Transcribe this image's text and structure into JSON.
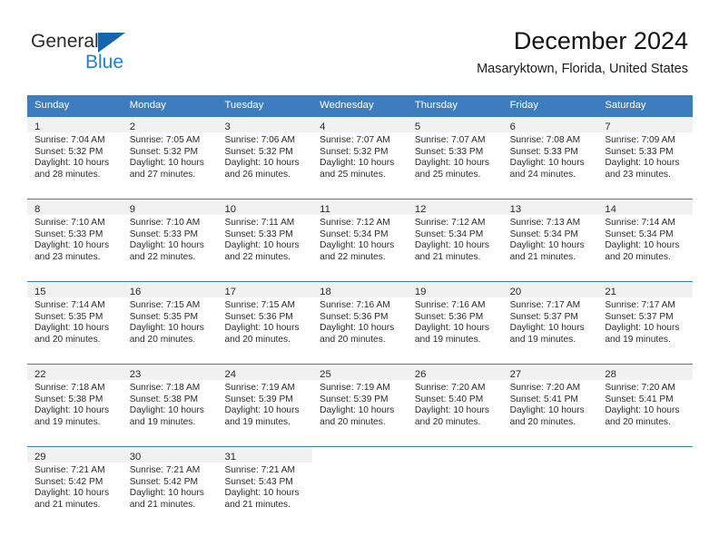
{
  "brand": {
    "name_part1": "General",
    "name_part2": "Blue"
  },
  "header": {
    "title": "December 2024",
    "location": "Masaryktown, Florida, United States"
  },
  "calendar": {
    "weekday_headers": [
      "Sunday",
      "Monday",
      "Tuesday",
      "Wednesday",
      "Thursday",
      "Friday",
      "Saturday"
    ],
    "colors": {
      "header_blue": "#3d7dbf",
      "brand_blue": "#1f7fd4",
      "logo_triangle": "#1565b0",
      "day_band_gray": "#f1f1f1"
    },
    "weeks": [
      [
        {
          "day": "1",
          "sunrise": "Sunrise: 7:04 AM",
          "sunset": "Sunset: 5:32 PM",
          "daylight_line1": "Daylight: 10 hours",
          "daylight_line2": "and 28 minutes."
        },
        {
          "day": "2",
          "sunrise": "Sunrise: 7:05 AM",
          "sunset": "Sunset: 5:32 PM",
          "daylight_line1": "Daylight: 10 hours",
          "daylight_line2": "and 27 minutes."
        },
        {
          "day": "3",
          "sunrise": "Sunrise: 7:06 AM",
          "sunset": "Sunset: 5:32 PM",
          "daylight_line1": "Daylight: 10 hours",
          "daylight_line2": "and 26 minutes."
        },
        {
          "day": "4",
          "sunrise": "Sunrise: 7:07 AM",
          "sunset": "Sunset: 5:32 PM",
          "daylight_line1": "Daylight: 10 hours",
          "daylight_line2": "and 25 minutes."
        },
        {
          "day": "5",
          "sunrise": "Sunrise: 7:07 AM",
          "sunset": "Sunset: 5:33 PM",
          "daylight_line1": "Daylight: 10 hours",
          "daylight_line2": "and 25 minutes."
        },
        {
          "day": "6",
          "sunrise": "Sunrise: 7:08 AM",
          "sunset": "Sunset: 5:33 PM",
          "daylight_line1": "Daylight: 10 hours",
          "daylight_line2": "and 24 minutes."
        },
        {
          "day": "7",
          "sunrise": "Sunrise: 7:09 AM",
          "sunset": "Sunset: 5:33 PM",
          "daylight_line1": "Daylight: 10 hours",
          "daylight_line2": "and 23 minutes."
        }
      ],
      [
        {
          "day": "8",
          "sunrise": "Sunrise: 7:10 AM",
          "sunset": "Sunset: 5:33 PM",
          "daylight_line1": "Daylight: 10 hours",
          "daylight_line2": "and 23 minutes."
        },
        {
          "day": "9",
          "sunrise": "Sunrise: 7:10 AM",
          "sunset": "Sunset: 5:33 PM",
          "daylight_line1": "Daylight: 10 hours",
          "daylight_line2": "and 22 minutes."
        },
        {
          "day": "10",
          "sunrise": "Sunrise: 7:11 AM",
          "sunset": "Sunset: 5:33 PM",
          "daylight_line1": "Daylight: 10 hours",
          "daylight_line2": "and 22 minutes."
        },
        {
          "day": "11",
          "sunrise": "Sunrise: 7:12 AM",
          "sunset": "Sunset: 5:34 PM",
          "daylight_line1": "Daylight: 10 hours",
          "daylight_line2": "and 22 minutes."
        },
        {
          "day": "12",
          "sunrise": "Sunrise: 7:12 AM",
          "sunset": "Sunset: 5:34 PM",
          "daylight_line1": "Daylight: 10 hours",
          "daylight_line2": "and 21 minutes."
        },
        {
          "day": "13",
          "sunrise": "Sunrise: 7:13 AM",
          "sunset": "Sunset: 5:34 PM",
          "daylight_line1": "Daylight: 10 hours",
          "daylight_line2": "and 21 minutes."
        },
        {
          "day": "14",
          "sunrise": "Sunrise: 7:14 AM",
          "sunset": "Sunset: 5:34 PM",
          "daylight_line1": "Daylight: 10 hours",
          "daylight_line2": "and 20 minutes."
        }
      ],
      [
        {
          "day": "15",
          "sunrise": "Sunrise: 7:14 AM",
          "sunset": "Sunset: 5:35 PM",
          "daylight_line1": "Daylight: 10 hours",
          "daylight_line2": "and 20 minutes."
        },
        {
          "day": "16",
          "sunrise": "Sunrise: 7:15 AM",
          "sunset": "Sunset: 5:35 PM",
          "daylight_line1": "Daylight: 10 hours",
          "daylight_line2": "and 20 minutes."
        },
        {
          "day": "17",
          "sunrise": "Sunrise: 7:15 AM",
          "sunset": "Sunset: 5:36 PM",
          "daylight_line1": "Daylight: 10 hours",
          "daylight_line2": "and 20 minutes."
        },
        {
          "day": "18",
          "sunrise": "Sunrise: 7:16 AM",
          "sunset": "Sunset: 5:36 PM",
          "daylight_line1": "Daylight: 10 hours",
          "daylight_line2": "and 20 minutes."
        },
        {
          "day": "19",
          "sunrise": "Sunrise: 7:16 AM",
          "sunset": "Sunset: 5:36 PM",
          "daylight_line1": "Daylight: 10 hours",
          "daylight_line2": "and 19 minutes."
        },
        {
          "day": "20",
          "sunrise": "Sunrise: 7:17 AM",
          "sunset": "Sunset: 5:37 PM",
          "daylight_line1": "Daylight: 10 hours",
          "daylight_line2": "and 19 minutes."
        },
        {
          "day": "21",
          "sunrise": "Sunrise: 7:17 AM",
          "sunset": "Sunset: 5:37 PM",
          "daylight_line1": "Daylight: 10 hours",
          "daylight_line2": "and 19 minutes."
        }
      ],
      [
        {
          "day": "22",
          "sunrise": "Sunrise: 7:18 AM",
          "sunset": "Sunset: 5:38 PM",
          "daylight_line1": "Daylight: 10 hours",
          "daylight_line2": "and 19 minutes."
        },
        {
          "day": "23",
          "sunrise": "Sunrise: 7:18 AM",
          "sunset": "Sunset: 5:38 PM",
          "daylight_line1": "Daylight: 10 hours",
          "daylight_line2": "and 19 minutes."
        },
        {
          "day": "24",
          "sunrise": "Sunrise: 7:19 AM",
          "sunset": "Sunset: 5:39 PM",
          "daylight_line1": "Daylight: 10 hours",
          "daylight_line2": "and 19 minutes."
        },
        {
          "day": "25",
          "sunrise": "Sunrise: 7:19 AM",
          "sunset": "Sunset: 5:39 PM",
          "daylight_line1": "Daylight: 10 hours",
          "daylight_line2": "and 20 minutes."
        },
        {
          "day": "26",
          "sunrise": "Sunrise: 7:20 AM",
          "sunset": "Sunset: 5:40 PM",
          "daylight_line1": "Daylight: 10 hours",
          "daylight_line2": "and 20 minutes."
        },
        {
          "day": "27",
          "sunrise": "Sunrise: 7:20 AM",
          "sunset": "Sunset: 5:41 PM",
          "daylight_line1": "Daylight: 10 hours",
          "daylight_line2": "and 20 minutes."
        },
        {
          "day": "28",
          "sunrise": "Sunrise: 7:20 AM",
          "sunset": "Sunset: 5:41 PM",
          "daylight_line1": "Daylight: 10 hours",
          "daylight_line2": "and 20 minutes."
        }
      ],
      [
        {
          "day": "29",
          "sunrise": "Sunrise: 7:21 AM",
          "sunset": "Sunset: 5:42 PM",
          "daylight_line1": "Daylight: 10 hours",
          "daylight_line2": "and 21 minutes."
        },
        {
          "day": "30",
          "sunrise": "Sunrise: 7:21 AM",
          "sunset": "Sunset: 5:42 PM",
          "daylight_line1": "Daylight: 10 hours",
          "daylight_line2": "and 21 minutes."
        },
        {
          "day": "31",
          "sunrise": "Sunrise: 7:21 AM",
          "sunset": "Sunset: 5:43 PM",
          "daylight_line1": "Daylight: 10 hours",
          "daylight_line2": "and 21 minutes."
        },
        {
          "day": "",
          "sunrise": "",
          "sunset": "",
          "daylight_line1": "",
          "daylight_line2": ""
        },
        {
          "day": "",
          "sunrise": "",
          "sunset": "",
          "daylight_line1": "",
          "daylight_line2": ""
        },
        {
          "day": "",
          "sunrise": "",
          "sunset": "",
          "daylight_line1": "",
          "daylight_line2": ""
        },
        {
          "day": "",
          "sunrise": "",
          "sunset": "",
          "daylight_line1": "",
          "daylight_line2": ""
        }
      ]
    ]
  }
}
